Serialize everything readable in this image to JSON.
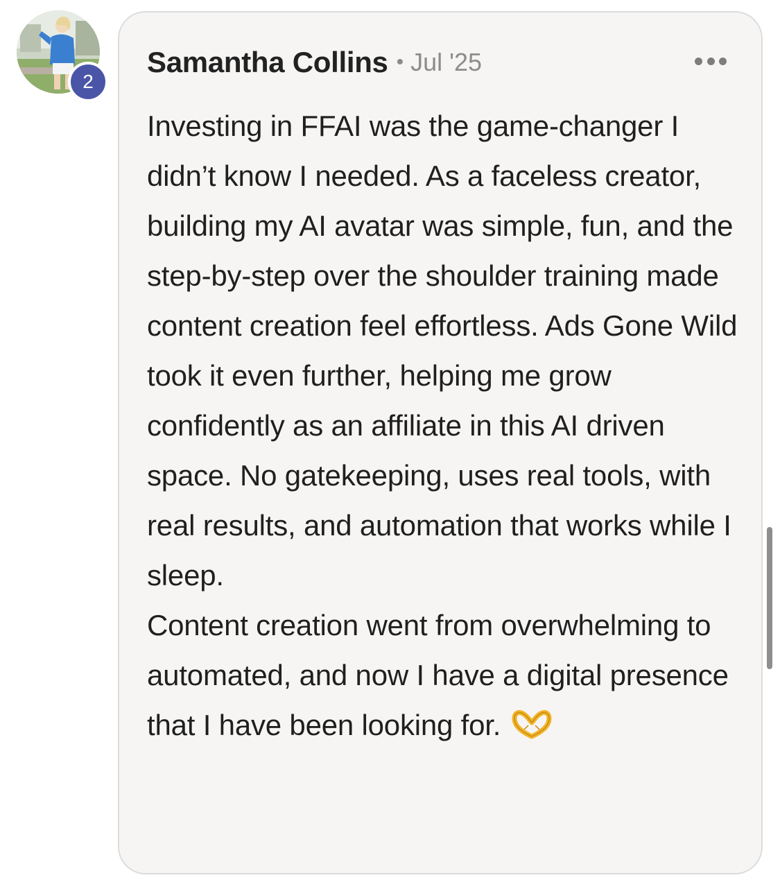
{
  "comment": {
    "author": "Samantha Collins",
    "separator": "•",
    "date": "Jul '25",
    "level_badge": "2",
    "avatar": "avatar-photo",
    "more_icon": "more-horizontal-icon",
    "paragraphs": [
      "Investing in FFAI was the game-changer I didn’t know I needed. As a faceless creator, building my AI avatar was simple, fun, and the step-by-step over the shoulder training made content creation feel effortless. Ads Gone Wild took it even further, helping me grow confidently as an affiliate in this AI driven space. No gatekeeping, uses real tools, with real results, and automation that works while I sleep.",
      "Content creation went from overwhelming to automated, and now I have a digital presence that I have been looking for."
    ],
    "emoji": "heart-hands-icon"
  },
  "colors": {
    "card_background": "#f6f5f4",
    "card_border": "#dcdcdc",
    "badge": "#4a55a8",
    "date_text": "#8c8c8c"
  }
}
